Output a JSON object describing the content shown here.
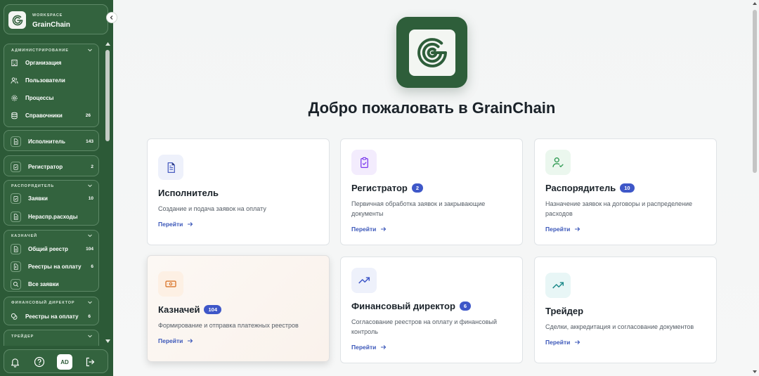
{
  "workspace": {
    "small_label": "WORKSPACE",
    "name": "GrainChain"
  },
  "sidebar": {
    "groups": [
      {
        "title": "АДМИНИСТРИРОВАНИЕ",
        "items": [
          {
            "label": "Организация",
            "count": ""
          },
          {
            "label": "Пользователи",
            "count": ""
          },
          {
            "label": "Процессы",
            "count": ""
          },
          {
            "label": "Справочники",
            "count": "26"
          }
        ]
      },
      {
        "title": "",
        "items": [
          {
            "label": "Исполнитель",
            "count": "143"
          }
        ]
      },
      {
        "title": "",
        "items": [
          {
            "label": "Регистратор",
            "count": "2"
          }
        ]
      },
      {
        "title": "РАСПОРЯДИТЕЛЬ",
        "items": [
          {
            "label": "Заявки",
            "count": "10"
          },
          {
            "label": "Нераспр.расходы",
            "count": ""
          }
        ]
      },
      {
        "title": "КАЗНАЧЕЙ",
        "items": [
          {
            "label": "Общий реестр",
            "count": "104"
          },
          {
            "label": "Реестры на оплату",
            "count": "6"
          },
          {
            "label": "Все заявки",
            "count": ""
          }
        ]
      },
      {
        "title": "ФИНАНСОВЫЙ ДИРЕКТОР",
        "items": [
          {
            "label": "Реестры на оплату",
            "count": "6"
          }
        ]
      },
      {
        "title": "ТРЕЙДЕР",
        "items": []
      }
    ],
    "footer": {
      "avatar": "AD",
      "icons": [
        "bell-icon",
        "help-icon",
        "logout-icon"
      ]
    }
  },
  "main": {
    "welcome": "Добро пожаловать в GrainChain",
    "cards": [
      {
        "title": "Исполнитель",
        "badge": "",
        "description": "Создание и подача заявок на оплату",
        "link": "Перейти",
        "icon": "document-icon",
        "icon_color": "#4a5fc1",
        "icon_bg": "#eef1fb"
      },
      {
        "title": "Регистратор",
        "badge": "2",
        "description": "Первичная обработка заявок и закрывающие документы",
        "link": "Перейти",
        "icon": "clipboard-check-icon",
        "icon_color": "#7c3aed",
        "icon_bg": "#f3ecfd"
      },
      {
        "title": "Распорядитель",
        "badge": "10",
        "description": "Назначение заявок на договоры и распределение расходов",
        "link": "Перейти",
        "icon": "user-check-icon",
        "icon_color": "#2f9a52",
        "icon_bg": "#ebf7ee"
      },
      {
        "title": "Казначей",
        "badge": "104",
        "description": "Формирование и отправка платежных реестров",
        "link": "Перейти",
        "icon": "banknote-icon",
        "icon_color": "#d9762b",
        "icon_bg": "#fdf0e4"
      },
      {
        "title": "Финансовый директор",
        "badge": "6",
        "description": "Согласование реестров на оплату и финансовый контроль",
        "link": "Перейти",
        "icon": "trending-up-icon",
        "icon_color": "#3e57c8",
        "icon_bg": "#eef1fb"
      },
      {
        "title": "Трейдер",
        "badge": "",
        "description": "Сделки, аккредитация и согласование документов",
        "link": "Перейти",
        "icon": "trending-up-icon",
        "icon_color": "#1f8a8a",
        "icon_bg": "#e8f6f6"
      }
    ]
  }
}
